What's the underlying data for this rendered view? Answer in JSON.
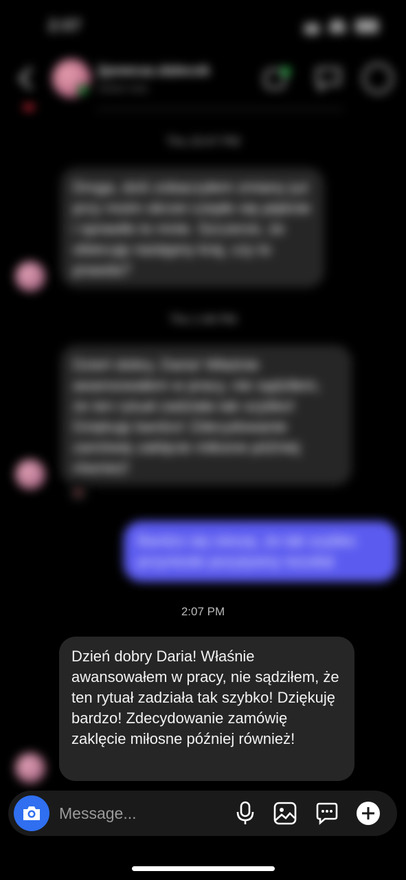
{
  "status_bar": {
    "time": "2:07"
  },
  "header": {
    "contact_name": "ŷpowcaz.dalecok",
    "contact_sub": "Active now"
  },
  "messages": [
    {
      "type": "timestamp",
      "text": "Thu 10:47 PM"
    },
    {
      "type": "incoming",
      "text": "Droga, dziś zobaczyłem zmiany już przy moim okrzei czepło się pięknie i sprawiło to mnie. Szczerze, że obiecuję następny kraj, czy to prawda?"
    },
    {
      "type": "timestamp",
      "text": "Thu 1:46 PM"
    },
    {
      "type": "incoming",
      "text": "Dzień dobry, Daria! Właśnie awansowałem w pracy, nie sądziłem, że ten rytuał zadziała tak szybko! Dziękuję bardzo! Zdecydowanie zamówię zaklęcie miłosne później również!",
      "reaction": "heart"
    },
    {
      "type": "outgoing",
      "text": "Bardzo się cieszę, że tak szybko przyniosło pozytywny rezultat"
    },
    {
      "type": "timestamp",
      "text": "2:07 PM"
    },
    {
      "type": "incoming",
      "text": "Dzień dobry Daria! Właśnie awansowałem w pracy, nie sądziłem, że ten rytuał zadziała tak szybko!  Dziękuję bardzo! Zdecydowanie zamówię zaklęcie miłosne później również!"
    }
  ],
  "composer": {
    "placeholder": "Message..."
  },
  "colors": {
    "accent": "#2f6ff0",
    "outgoing_bubble": "#5b5bf0",
    "incoming_bubble": "#262626"
  }
}
